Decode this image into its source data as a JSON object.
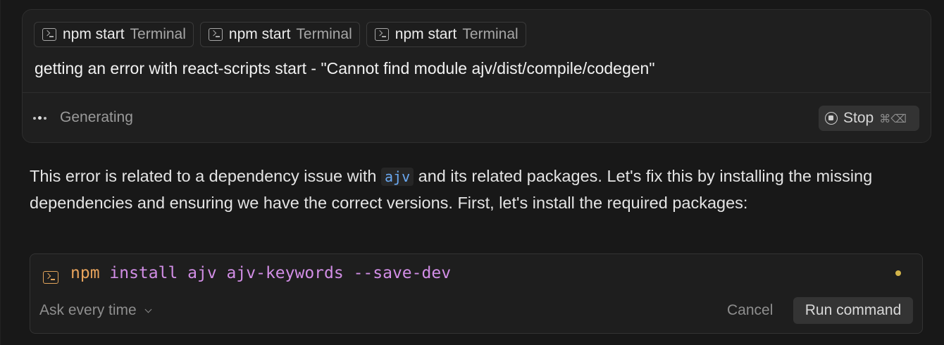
{
  "composer": {
    "chips": [
      {
        "label": "npm start",
        "kind": "Terminal",
        "icon": "terminal-icon"
      },
      {
        "label": "npm start",
        "kind": "Terminal",
        "icon": "terminal-icon"
      },
      {
        "label": "npm start",
        "kind": "Terminal",
        "icon": "terminal-icon"
      }
    ],
    "prompt": "getting an error with react-scripts start - \"Cannot find module ajv/dist/compile/codegen\"",
    "status": "Generating",
    "stop_label": "Stop",
    "stop_shortcut": "⌘⌫"
  },
  "answer": {
    "text_before": "This error is related to a dependency issue with ",
    "code": "ajv",
    "text_after": " and its related packages. Let's fix this by installing the missing dependencies and ensuring we have the correct versions. First, let's install the required packages:"
  },
  "command": {
    "program": "npm",
    "args": " install ajv ajv-keywords --save-dev",
    "approval_mode": "Ask every time",
    "cancel_label": "Cancel",
    "run_label": "Run command"
  },
  "colors": {
    "background": "#181818",
    "inline_code": "#6aa9f2",
    "command_program": "#e7a35c",
    "command_args": "#d28ee6",
    "status_dot": "#d2b44a"
  }
}
